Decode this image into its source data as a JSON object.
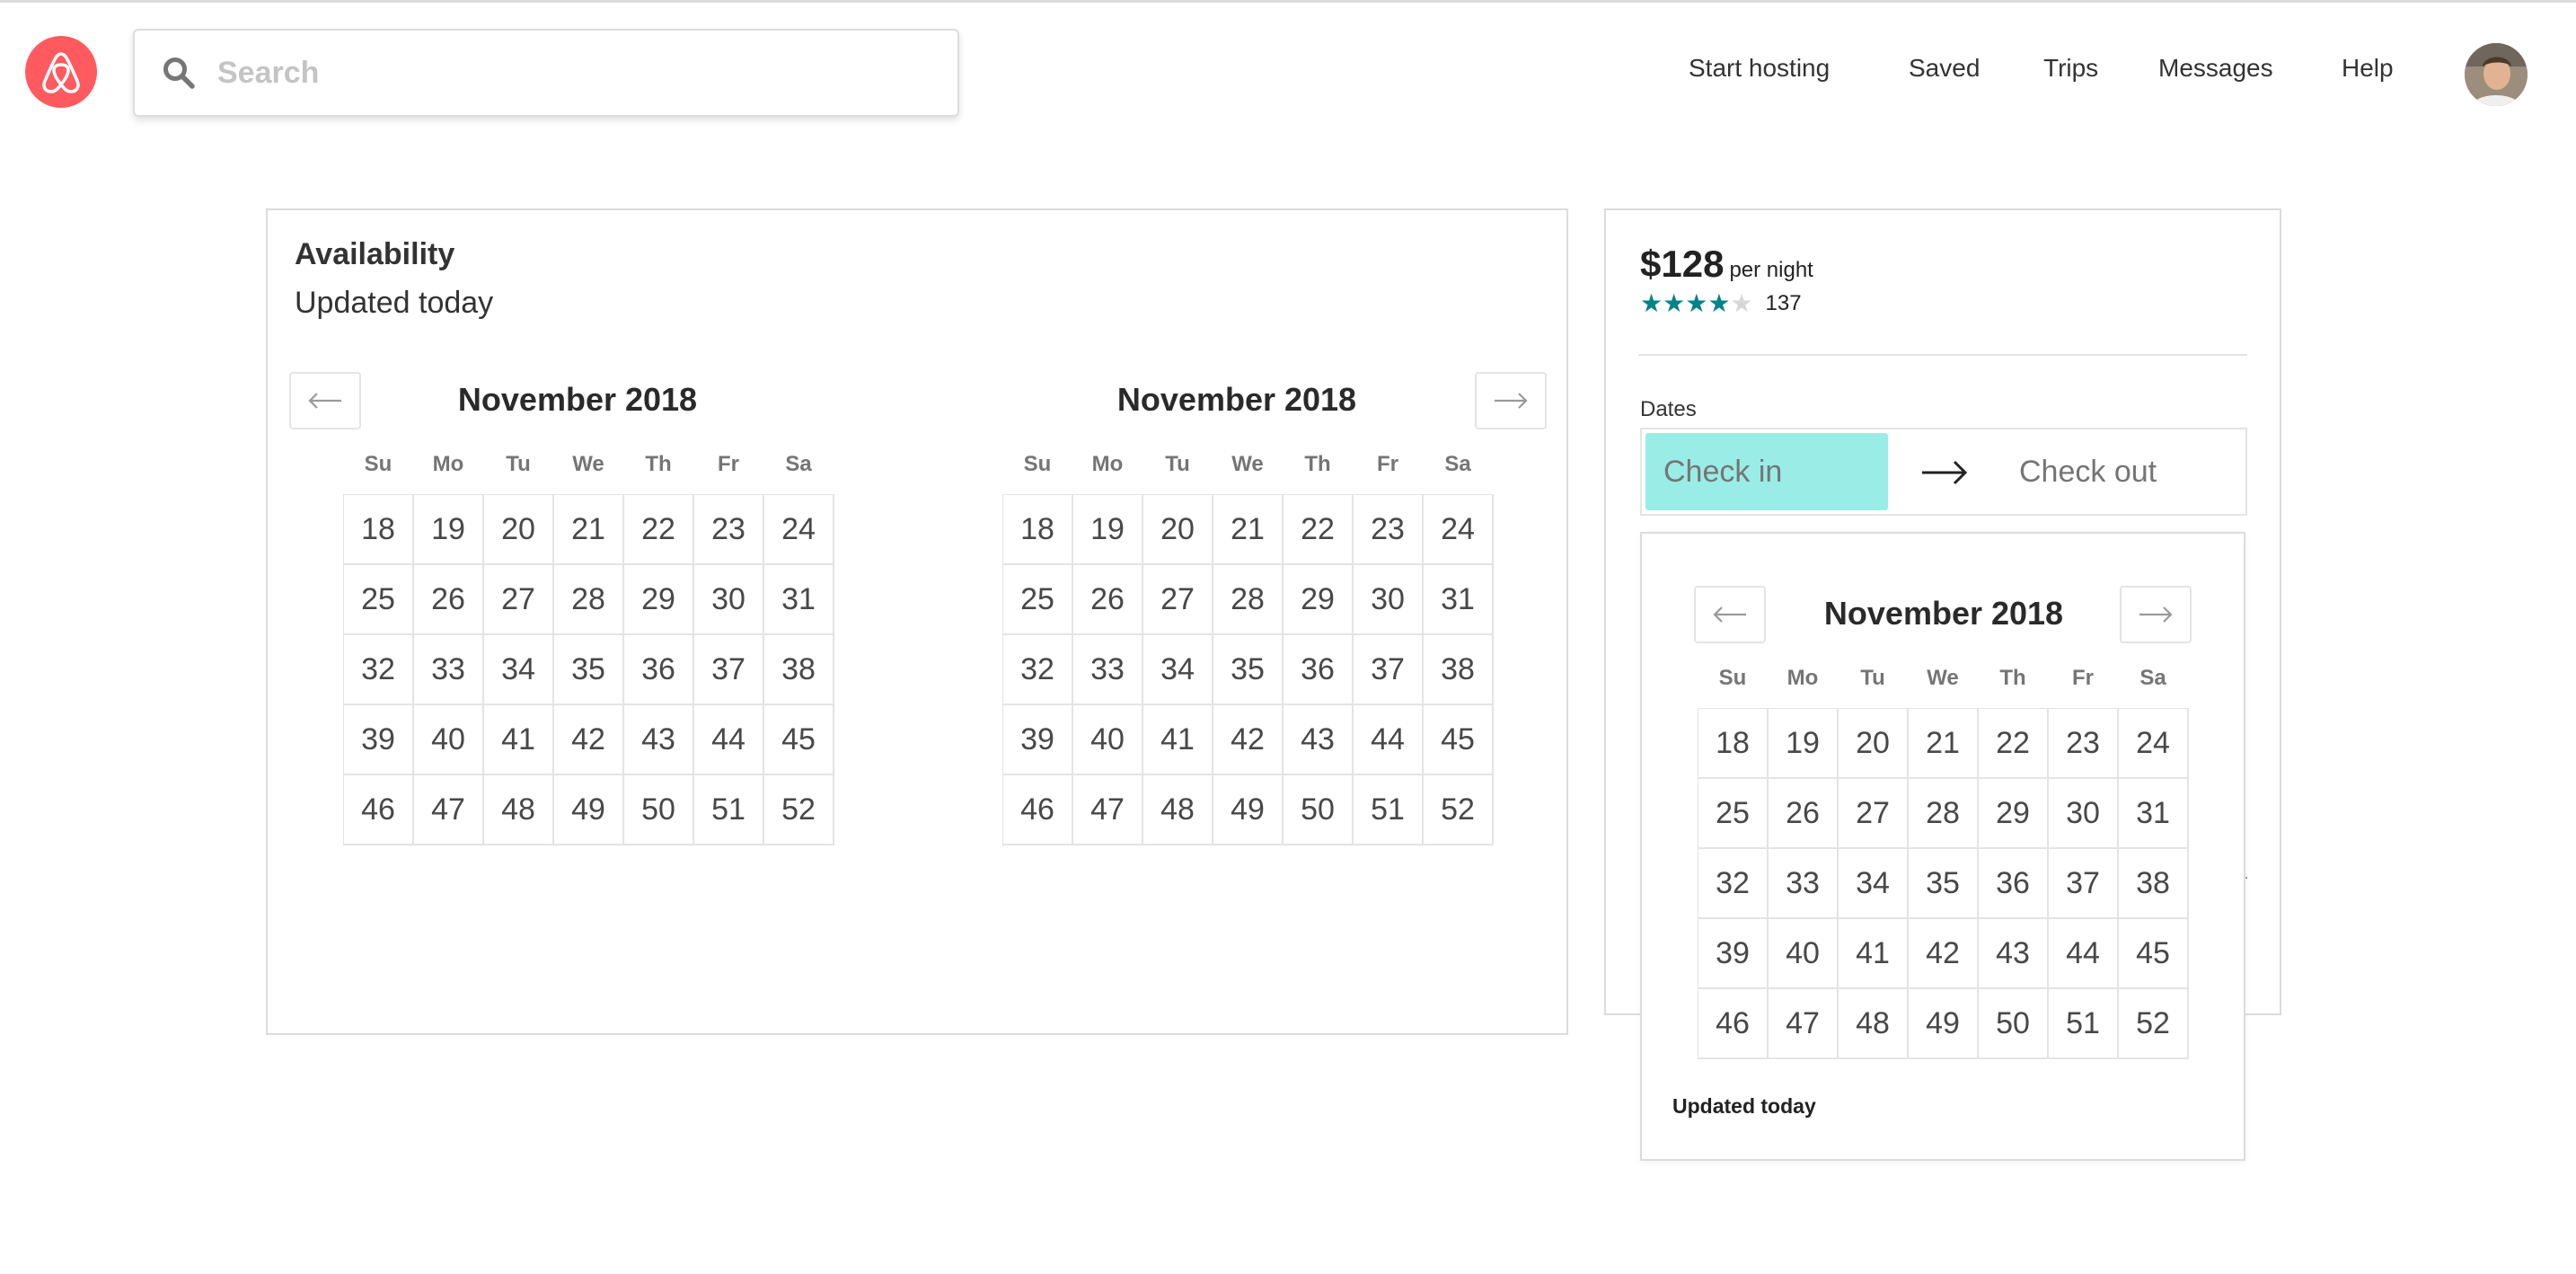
{
  "header": {
    "search_placeholder": "Search",
    "nav": [
      "Start hosting",
      "Saved",
      "Trips",
      "Messages",
      "Help"
    ]
  },
  "availability": {
    "title": "Availability",
    "subtitle": "Updated today",
    "months": [
      "November 2018",
      "November 2018"
    ]
  },
  "calendar": {
    "weekdays": [
      "Su",
      "Mo",
      "Tu",
      "We",
      "Th",
      "Fr",
      "Sa"
    ],
    "days": [
      "18",
      "19",
      "20",
      "21",
      "22",
      "23",
      "24",
      "25",
      "26",
      "27",
      "28",
      "29",
      "30",
      "31",
      "32",
      "33",
      "34",
      "35",
      "36",
      "37",
      "38",
      "39",
      "40",
      "41",
      "42",
      "43",
      "44",
      "45",
      "46",
      "47",
      "48",
      "49",
      "50",
      "51",
      "52"
    ]
  },
  "booking": {
    "price": "$128",
    "per_night": "per night",
    "rating": 4,
    "rating_max": 5,
    "review_count": "137",
    "dates_label": "Dates",
    "check_in": "Check in",
    "check_out": "Check out",
    "popup_month": "November 2018",
    "popup_footer": "Updated today"
  },
  "colors": {
    "brand": "#ff5a5f",
    "accent": "#008489",
    "check_in_highlight": "#99ede6"
  },
  "icons": [
    "airbnb-logo-icon",
    "search-icon",
    "arrow-left-icon",
    "arrow-right-icon",
    "star-icon"
  ]
}
